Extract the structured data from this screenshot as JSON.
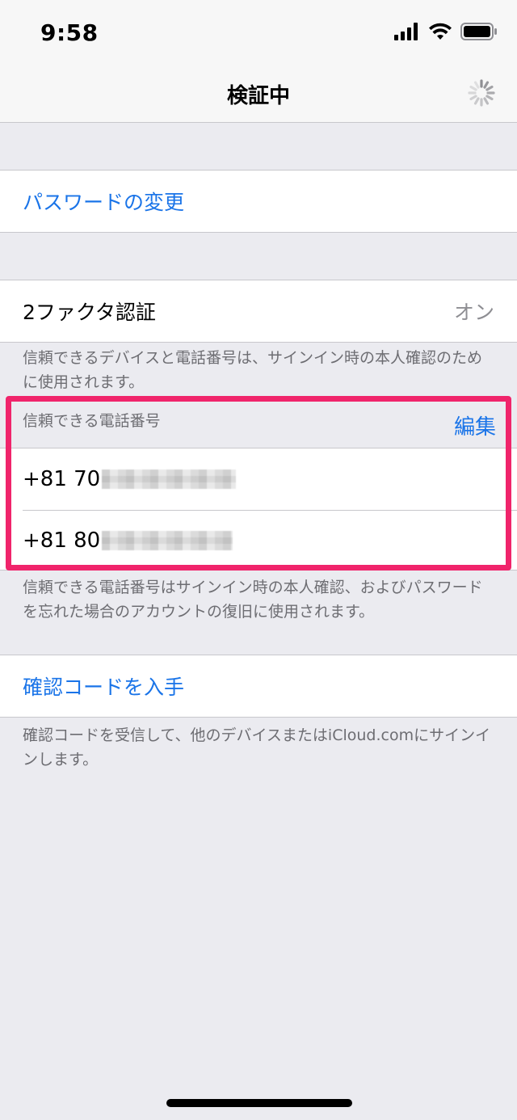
{
  "status_bar": {
    "time": "9:58"
  },
  "nav": {
    "title": "検証中"
  },
  "password": {
    "change_label": "パスワードの変更"
  },
  "two_factor": {
    "label": "2ファクタ認証",
    "value": "オン",
    "footer": "信頼できるデバイスと電話番号は、サインイン時の本人確認のために使用されます。"
  },
  "trusted_numbers": {
    "header": "信頼できる電話番号",
    "edit_label": "編集",
    "numbers": [
      {
        "prefix": "+81 70"
      },
      {
        "prefix": "+81 80"
      }
    ],
    "footer": "信頼できる電話番号はサインイン時の本人確認、およびパスワードを忘れた場合のアカウントの復旧に使用されます。"
  },
  "verification_code": {
    "label": "確認コードを入手",
    "footer": "確認コードを受信して、他のデバイスまたはiCloud.comにサインインします。"
  },
  "colors": {
    "accent": "#1a74e8",
    "highlight": "#f0246b",
    "background": "#ebebf0"
  }
}
